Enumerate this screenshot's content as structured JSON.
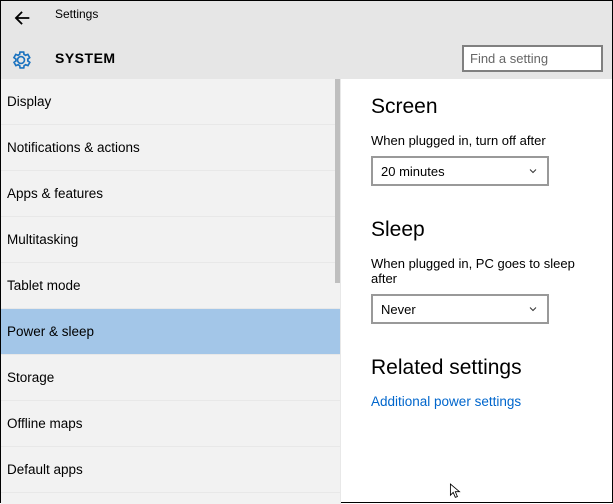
{
  "window": {
    "title": "Settings"
  },
  "page": {
    "title": "SYSTEM"
  },
  "search": {
    "placeholder": "Find a setting"
  },
  "sidebar": {
    "items": [
      {
        "label": "Display",
        "selected": false
      },
      {
        "label": "Notifications & actions",
        "selected": false
      },
      {
        "label": "Apps & features",
        "selected": false
      },
      {
        "label": "Multitasking",
        "selected": false
      },
      {
        "label": "Tablet mode",
        "selected": false
      },
      {
        "label": "Power & sleep",
        "selected": true
      },
      {
        "label": "Storage",
        "selected": false
      },
      {
        "label": "Offline maps",
        "selected": false
      },
      {
        "label": "Default apps",
        "selected": false
      }
    ]
  },
  "main": {
    "screen": {
      "heading": "Screen",
      "plugged_label": "When plugged in, turn off after",
      "plugged_value": "20 minutes"
    },
    "sleep": {
      "heading": "Sleep",
      "plugged_label": "When plugged in, PC goes to sleep after",
      "plugged_value": "Never"
    },
    "related": {
      "heading": "Related settings",
      "link_additional": "Additional power settings"
    }
  }
}
